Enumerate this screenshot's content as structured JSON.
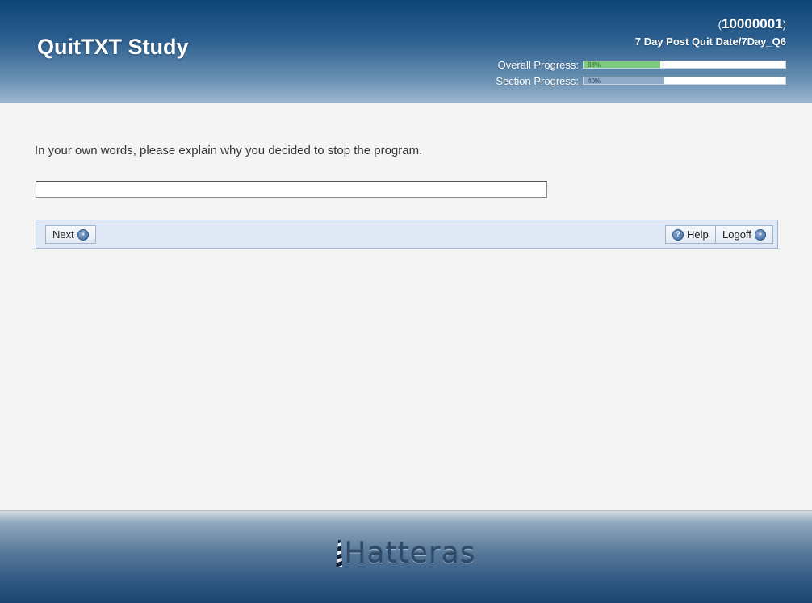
{
  "header": {
    "title": "QuitTXT Study",
    "participant_id": "10000001",
    "paren_open": "(",
    "paren_close": ")",
    "section_name": "7 Day Post Quit Date/7Day_Q6",
    "overall_progress": {
      "label": "Overall Progress:",
      "percent_text": "38%",
      "value": 0.38
    },
    "section_progress": {
      "label": "Section Progress:",
      "percent_text": "40%",
      "value": 0.4
    },
    "colors": {
      "overall_fill": "#7cc97f",
      "section_fill": "#8fa9c8",
      "header_dark": "#0e4577"
    }
  },
  "main": {
    "question": "In your own words, please explain why you decided to stop the program.",
    "answer_value": ""
  },
  "nav": {
    "next_label": "Next",
    "help_label": "Help",
    "logoff_label": "Logoff",
    "help_icon_glyph": "?",
    "arrow_icon_glyph": "»"
  },
  "footer": {
    "logo_text": "Hatteras",
    "logo_icon": "lighthouse-icon"
  }
}
